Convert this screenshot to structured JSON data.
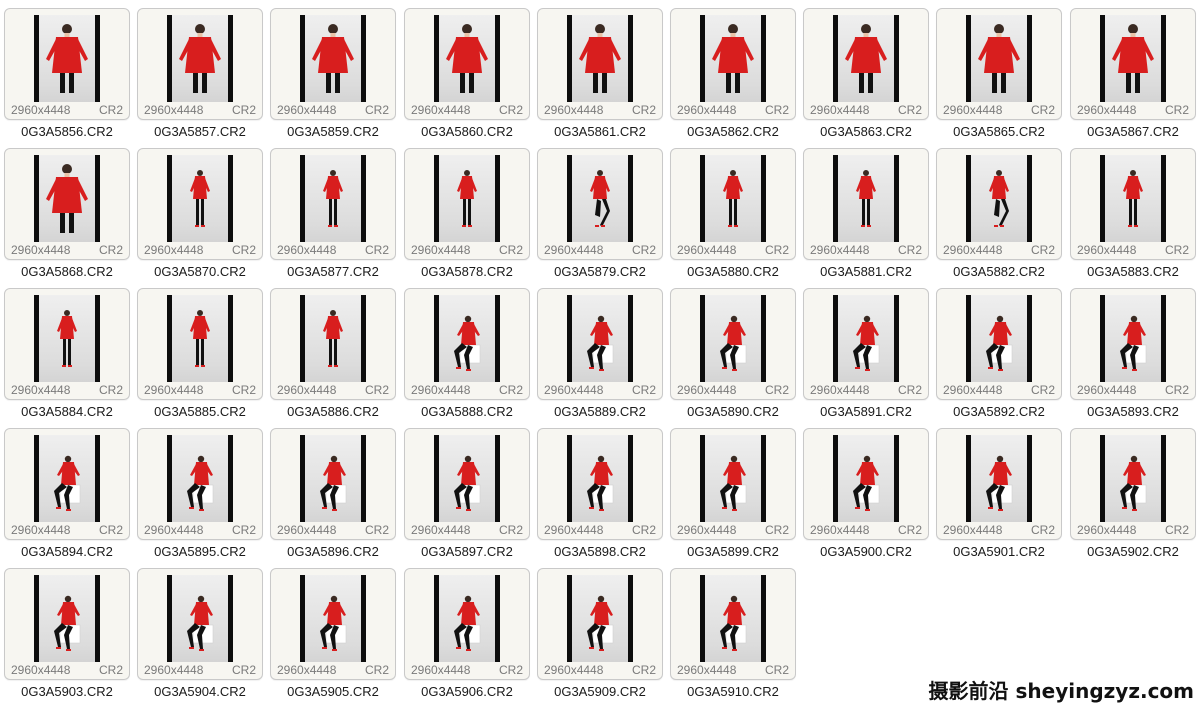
{
  "files": [
    {
      "name": "0G3A5856.CR2",
      "dims": "2960x4448",
      "ext": "CR2",
      "pose": "stand-front"
    },
    {
      "name": "0G3A5857.CR2",
      "dims": "2960x4448",
      "ext": "CR2",
      "pose": "stand-front"
    },
    {
      "name": "0G3A5859.CR2",
      "dims": "2960x4448",
      "ext": "CR2",
      "pose": "stand-front"
    },
    {
      "name": "0G3A5860.CR2",
      "dims": "2960x4448",
      "ext": "CR2",
      "pose": "stand-front"
    },
    {
      "name": "0G3A5861.CR2",
      "dims": "2960x4448",
      "ext": "CR2",
      "pose": "stand-front"
    },
    {
      "name": "0G3A5862.CR2",
      "dims": "2960x4448",
      "ext": "CR2",
      "pose": "stand-front"
    },
    {
      "name": "0G3A5863.CR2",
      "dims": "2960x4448",
      "ext": "CR2",
      "pose": "stand-front"
    },
    {
      "name": "0G3A5865.CR2",
      "dims": "2960x4448",
      "ext": "CR2",
      "pose": "stand-front"
    },
    {
      "name": "0G3A5867.CR2",
      "dims": "2960x4448",
      "ext": "CR2",
      "pose": "stand-front"
    },
    {
      "name": "0G3A5868.CR2",
      "dims": "2960x4448",
      "ext": "CR2",
      "pose": "stand-front"
    },
    {
      "name": "0G3A5870.CR2",
      "dims": "2960x4448",
      "ext": "CR2",
      "pose": "stand-full"
    },
    {
      "name": "0G3A5877.CR2",
      "dims": "2960x4448",
      "ext": "CR2",
      "pose": "stand-full"
    },
    {
      "name": "0G3A5878.CR2",
      "dims": "2960x4448",
      "ext": "CR2",
      "pose": "stand-full"
    },
    {
      "name": "0G3A5879.CR2",
      "dims": "2960x4448",
      "ext": "CR2",
      "pose": "stand-leg"
    },
    {
      "name": "0G3A5880.CR2",
      "dims": "2960x4448",
      "ext": "CR2",
      "pose": "stand-full"
    },
    {
      "name": "0G3A5881.CR2",
      "dims": "2960x4448",
      "ext": "CR2",
      "pose": "stand-full"
    },
    {
      "name": "0G3A5882.CR2",
      "dims": "2960x4448",
      "ext": "CR2",
      "pose": "stand-leg"
    },
    {
      "name": "0G3A5883.CR2",
      "dims": "2960x4448",
      "ext": "CR2",
      "pose": "stand-full"
    },
    {
      "name": "0G3A5884.CR2",
      "dims": "2960x4448",
      "ext": "CR2",
      "pose": "stand-full"
    },
    {
      "name": "0G3A5885.CR2",
      "dims": "2960x4448",
      "ext": "CR2",
      "pose": "stand-full"
    },
    {
      "name": "0G3A5886.CR2",
      "dims": "2960x4448",
      "ext": "CR2",
      "pose": "stand-full"
    },
    {
      "name": "0G3A5888.CR2",
      "dims": "2960x4448",
      "ext": "CR2",
      "pose": "sit"
    },
    {
      "name": "0G3A5889.CR2",
      "dims": "2960x4448",
      "ext": "CR2",
      "pose": "sit"
    },
    {
      "name": "0G3A5890.CR2",
      "dims": "2960x4448",
      "ext": "CR2",
      "pose": "sit"
    },
    {
      "name": "0G3A5891.CR2",
      "dims": "2960x4448",
      "ext": "CR2",
      "pose": "sit"
    },
    {
      "name": "0G3A5892.CR2",
      "dims": "2960x4448",
      "ext": "CR2",
      "pose": "sit"
    },
    {
      "name": "0G3A5893.CR2",
      "dims": "2960x4448",
      "ext": "CR2",
      "pose": "sit"
    },
    {
      "name": "0G3A5894.CR2",
      "dims": "2960x4448",
      "ext": "CR2",
      "pose": "sit"
    },
    {
      "name": "0G3A5895.CR2",
      "dims": "2960x4448",
      "ext": "CR2",
      "pose": "sit"
    },
    {
      "name": "0G3A5896.CR2",
      "dims": "2960x4448",
      "ext": "CR2",
      "pose": "sit"
    },
    {
      "name": "0G3A5897.CR2",
      "dims": "2960x4448",
      "ext": "CR2",
      "pose": "sit"
    },
    {
      "name": "0G3A5898.CR2",
      "dims": "2960x4448",
      "ext": "CR2",
      "pose": "sit"
    },
    {
      "name": "0G3A5899.CR2",
      "dims": "2960x4448",
      "ext": "CR2",
      "pose": "sit"
    },
    {
      "name": "0G3A5900.CR2",
      "dims": "2960x4448",
      "ext": "CR2",
      "pose": "sit"
    },
    {
      "name": "0G3A5901.CR2",
      "dims": "2960x4448",
      "ext": "CR2",
      "pose": "sit"
    },
    {
      "name": "0G3A5902.CR2",
      "dims": "2960x4448",
      "ext": "CR2",
      "pose": "sit"
    },
    {
      "name": "0G3A5903.CR2",
      "dims": "2960x4448",
      "ext": "CR2",
      "pose": "sit"
    },
    {
      "name": "0G3A5904.CR2",
      "dims": "2960x4448",
      "ext": "CR2",
      "pose": "sit"
    },
    {
      "name": "0G3A5905.CR2",
      "dims": "2960x4448",
      "ext": "CR2",
      "pose": "sit"
    },
    {
      "name": "0G3A5906.CR2",
      "dims": "2960x4448",
      "ext": "CR2",
      "pose": "sit"
    },
    {
      "name": "0G3A5909.CR2",
      "dims": "2960x4448",
      "ext": "CR2",
      "pose": "sit"
    },
    {
      "name": "0G3A5910.CR2",
      "dims": "2960x4448",
      "ext": "CR2",
      "pose": "sit"
    }
  ],
  "colors": {
    "card_bg": "#f7f6f1",
    "card_border": "#c9c9c9",
    "backdrop": "#0d0d0d",
    "outfit": "#d81e1e",
    "meta_text": "#7a7a7a",
    "filename_text": "#1a1a1a"
  },
  "icons": {
    "thumbnail": "photo-thumbnail-icon"
  },
  "watermark": "摄影前沿 sheyingzyz.com"
}
